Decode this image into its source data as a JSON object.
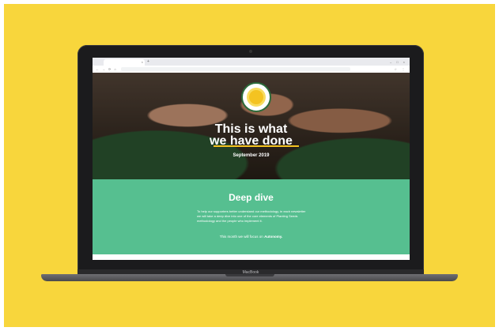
{
  "browser": {
    "tab_title": "",
    "tab_close": "×",
    "new_tab": "+",
    "window_controls": [
      "–",
      "□",
      "×"
    ],
    "nav_icons": [
      "←",
      "→",
      "⟳",
      "⌂"
    ],
    "toolbar_icons": [
      "☆",
      "⋮"
    ]
  },
  "hero": {
    "title_line1": "This is what",
    "title_line2": "we have done",
    "date": "September 2019"
  },
  "deep_dive": {
    "title": "Deep dive",
    "body": "To help our supporters better understand our methodology, in each newsletter we will take a deep dive into one of the core elements of Planting Seeds methodology and the people who implement it.",
    "focus_prefix": "This month we will focus on",
    "focus_topic": "Autonomy."
  },
  "laptop": {
    "brand": "MacBook"
  },
  "colors": {
    "background": "#f8d63c",
    "section_green": "#56bf90",
    "accent_yellow": "#f4c321"
  }
}
